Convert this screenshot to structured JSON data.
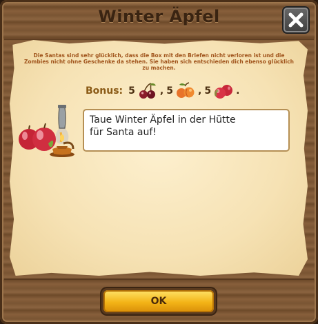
{
  "dialog": {
    "title": "Winter Äpfel",
    "close_icon": "close-x-icon",
    "description": "Die Santas sind sehr glücklich, dass die Box mit den Briefen nicht verloren ist und die Zombies nicht ohne Geschenke da stehen. Sie haben sich entschieden dich ebenso glücklich zu machen.",
    "bonus": {
      "label": "Bonus:",
      "items": [
        {
          "amount": "5",
          "icon": "cherries-icon",
          "sep": ","
        },
        {
          "amount": "5",
          "icon": "apricots-icon",
          "sep": ","
        },
        {
          "amount": "5",
          "icon": "apples-icon",
          "sep": "."
        }
      ]
    },
    "quest_icon": "apples-and-lantern-icon",
    "task_text": "Taue Winter Äpfel in der Hütte\nfür Santa auf!",
    "ok_label": "OK"
  },
  "colors": {
    "wood": "#7a5533",
    "parchment": "#f6e2b4",
    "description_text": "#a0541c",
    "ok_button": "#f3b417"
  }
}
